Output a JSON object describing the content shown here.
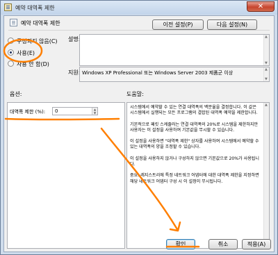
{
  "titlebar": {
    "title": "예약 대역폭 제한",
    "close_label": "✕"
  },
  "header": {
    "setting_name": "예약 대역폭 제한",
    "prev_button": "이전 설정(P)",
    "next_button": "다음 설정(N)"
  },
  "state_options": [
    {
      "label": "구성되지 않음(C)",
      "selected": false
    },
    {
      "label": "사용(E)",
      "selected": true
    },
    {
      "label": "사용 안 함(D)",
      "selected": false
    }
  ],
  "comment": {
    "label": "설명:",
    "value": ""
  },
  "supported": {
    "label": "지원:",
    "value": "Windows XP Professional 또는 Windows Server 2003 제품군 이상"
  },
  "options": {
    "label": "옵션:",
    "bandwidth_label": "대역폭 제한 (%):",
    "bandwidth_value": "0"
  },
  "help": {
    "label": "도움말:",
    "text": "시스템에서 예약할 수 있는 연결 대역폭의 백분율을 결정합니다. 이 값은 시스템에서 실행되는 모든 프로그램의 결합된 대역폭 예약을 제한합니다.\n\n기본적으로 패킷 스케줄러는 연결 대역폭의 20%로 시스템을 제한하지만 사용자는 이 설정을 사용하여 기본값을 무시할 수 있습니다.\n\n이 설정을 사용하면 \"대역폭 제한\" 상자를 사용하여 시스템에서 예약할 수 있는 대역폭의 양을 조정할 수 있습니다.\n\n이 설정을 사용하지 않거나 구성하지 않으면 기본값으로 20%가 사용됩니다.\n\n중요: 레지스트리에 특정 네트워크 어댑터에 대한 대역폭 제한을 지정하면 해당 네트워크 어댑터 구성 시 이 설정이 무시됩니다."
  },
  "footer": {
    "ok": "확인",
    "cancel": "취소",
    "apply": "적용(A)"
  },
  "colors": {
    "annotation": "#ff7f00",
    "window_frame": "#cfdcec",
    "client_bg": "#f0f0f0"
  }
}
